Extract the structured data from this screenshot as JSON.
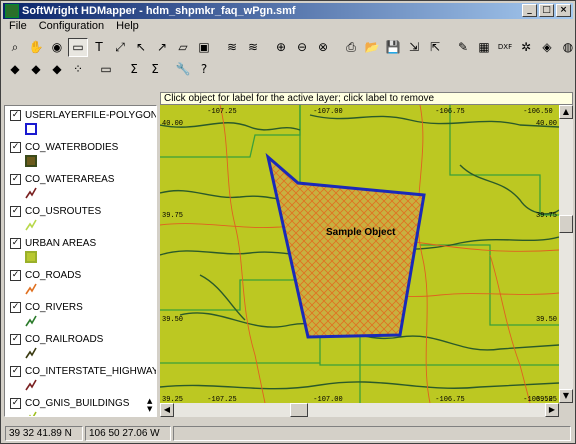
{
  "window": {
    "title": "SoftWright HDMapper - hdm_shpmkr_faq_wPgn.smf",
    "controls": [
      "_",
      "□",
      "×"
    ]
  },
  "menu": [
    "File",
    "Configuration",
    "Help"
  ],
  "toolbar_row1": [
    {
      "icon": "zoom-icon",
      "glyph": "⌕"
    },
    {
      "icon": "hand-pan-icon",
      "glyph": "✋"
    },
    {
      "icon": "eye-icon",
      "glyph": "◉"
    },
    {
      "icon": "label-tool-icon",
      "glyph": "▭",
      "active": true
    },
    {
      "icon": "text-tool-icon",
      "glyph": "T"
    },
    {
      "icon": "measure-icon",
      "glyph": "⤢"
    },
    {
      "icon": "select-arrow-icon",
      "glyph": "↖"
    },
    {
      "icon": "select-point-icon",
      "glyph": "↗"
    },
    {
      "icon": "area-icon",
      "glyph": "▱"
    },
    {
      "icon": "picture-icon",
      "glyph": "▣"
    },
    {
      "icon": "layers-icon",
      "glyph": "≋"
    },
    {
      "icon": "layers-edit-icon",
      "glyph": "≋"
    },
    {
      "icon": "zoom-in-icon",
      "glyph": "⊕"
    },
    {
      "icon": "zoom-out-icon",
      "glyph": "⊖"
    },
    {
      "icon": "zoom-cancel-icon",
      "glyph": "⊗"
    },
    {
      "icon": "print-icon",
      "glyph": "⎙"
    },
    {
      "icon": "open-folder-icon",
      "glyph": "📂"
    },
    {
      "icon": "save-icon",
      "glyph": "💾"
    },
    {
      "icon": "import-icon",
      "glyph": "⇲"
    },
    {
      "icon": "export-icon",
      "glyph": "⇱"
    },
    {
      "icon": "edit-record-icon",
      "glyph": "✎"
    },
    {
      "icon": "database-icon",
      "glyph": "▦"
    },
    {
      "icon": "dxf-icon",
      "glyph": "DXF"
    },
    {
      "icon": "settings-icon",
      "glyph": "✲"
    },
    {
      "icon": "color-palette-icon",
      "glyph": "◈"
    },
    {
      "icon": "globe-icon",
      "glyph": "◍"
    }
  ],
  "toolbar_row2": [
    {
      "icon": "layer-style-icon",
      "glyph": "◆"
    },
    {
      "icon": "layer-add-icon",
      "glyph": "◆"
    },
    {
      "icon": "layer-color-icon",
      "glyph": "◆"
    },
    {
      "icon": "points-icon",
      "glyph": "⁘"
    },
    {
      "icon": "label-add-icon",
      "glyph": "▭"
    },
    {
      "icon": "sum-icon",
      "glyph": "Σ"
    },
    {
      "icon": "sum-select-icon",
      "glyph": "Σ"
    },
    {
      "icon": "tools-icon",
      "glyph": "🔧"
    },
    {
      "icon": "help-icon",
      "glyph": "?"
    }
  ],
  "hint_text": "Click object for label for the active layer; click label to remove",
  "layers": [
    {
      "name": "USERLAYERFILE-POLYGON",
      "checked": true,
      "swatch": "box",
      "color": "#1a1ad0",
      "fill": "#ffffff"
    },
    {
      "name": "CO_WATERBODIES",
      "checked": true,
      "swatch": "box",
      "color": "#3a4a1a",
      "fill": "#6b5a1c"
    },
    {
      "name": "CO_WATERAREAS",
      "checked": true,
      "swatch": "line",
      "color": "#7a2020"
    },
    {
      "name": "CO_USROUTES",
      "checked": true,
      "swatch": "line",
      "color": "#b8d84a"
    },
    {
      "name": "URBAN AREAS",
      "checked": true,
      "swatch": "box",
      "color": "#9ab02a",
      "fill": "#b8c830"
    },
    {
      "name": "CO_ROADS",
      "checked": true,
      "swatch": "line",
      "color": "#e07020"
    },
    {
      "name": "CO_RIVERS",
      "checked": true,
      "swatch": "line",
      "color": "#2a7a2a"
    },
    {
      "name": "CO_RAILROADS",
      "checked": true,
      "swatch": "line",
      "color": "#3a3a10"
    },
    {
      "name": "CO_INTERSTATE_HIGHWAY",
      "checked": true,
      "swatch": "line",
      "color": "#7a2020"
    },
    {
      "name": "CO_GNIS_BUILDINGS",
      "checked": true,
      "swatch": "line",
      "color": "#a0c020"
    }
  ],
  "map": {
    "object_label": "Sample Object",
    "coord_labels_top": [
      "-107.25",
      "-107.00",
      "-106.75",
      "-106.50"
    ],
    "coord_labels_bottom": [
      "-107.25",
      "-107.00",
      "-106.75",
      "-106.50"
    ],
    "coord_labels_left": [
      "40.00",
      "39.75",
      "39.50",
      "39.25"
    ],
    "coord_labels_right": [
      "40.00",
      "39.75",
      "39.50",
      "39.25"
    ],
    "colors": {
      "background": "#bcc822",
      "polygon_stroke": "#1a2ab8",
      "hatch": "#e07020",
      "county": "#3aa03a",
      "roads": "#e06020",
      "rivers": "#2a5a2a"
    }
  },
  "status": {
    "latitude": "39 32 41.89 N",
    "longitude": "106 50 27.06 W"
  }
}
